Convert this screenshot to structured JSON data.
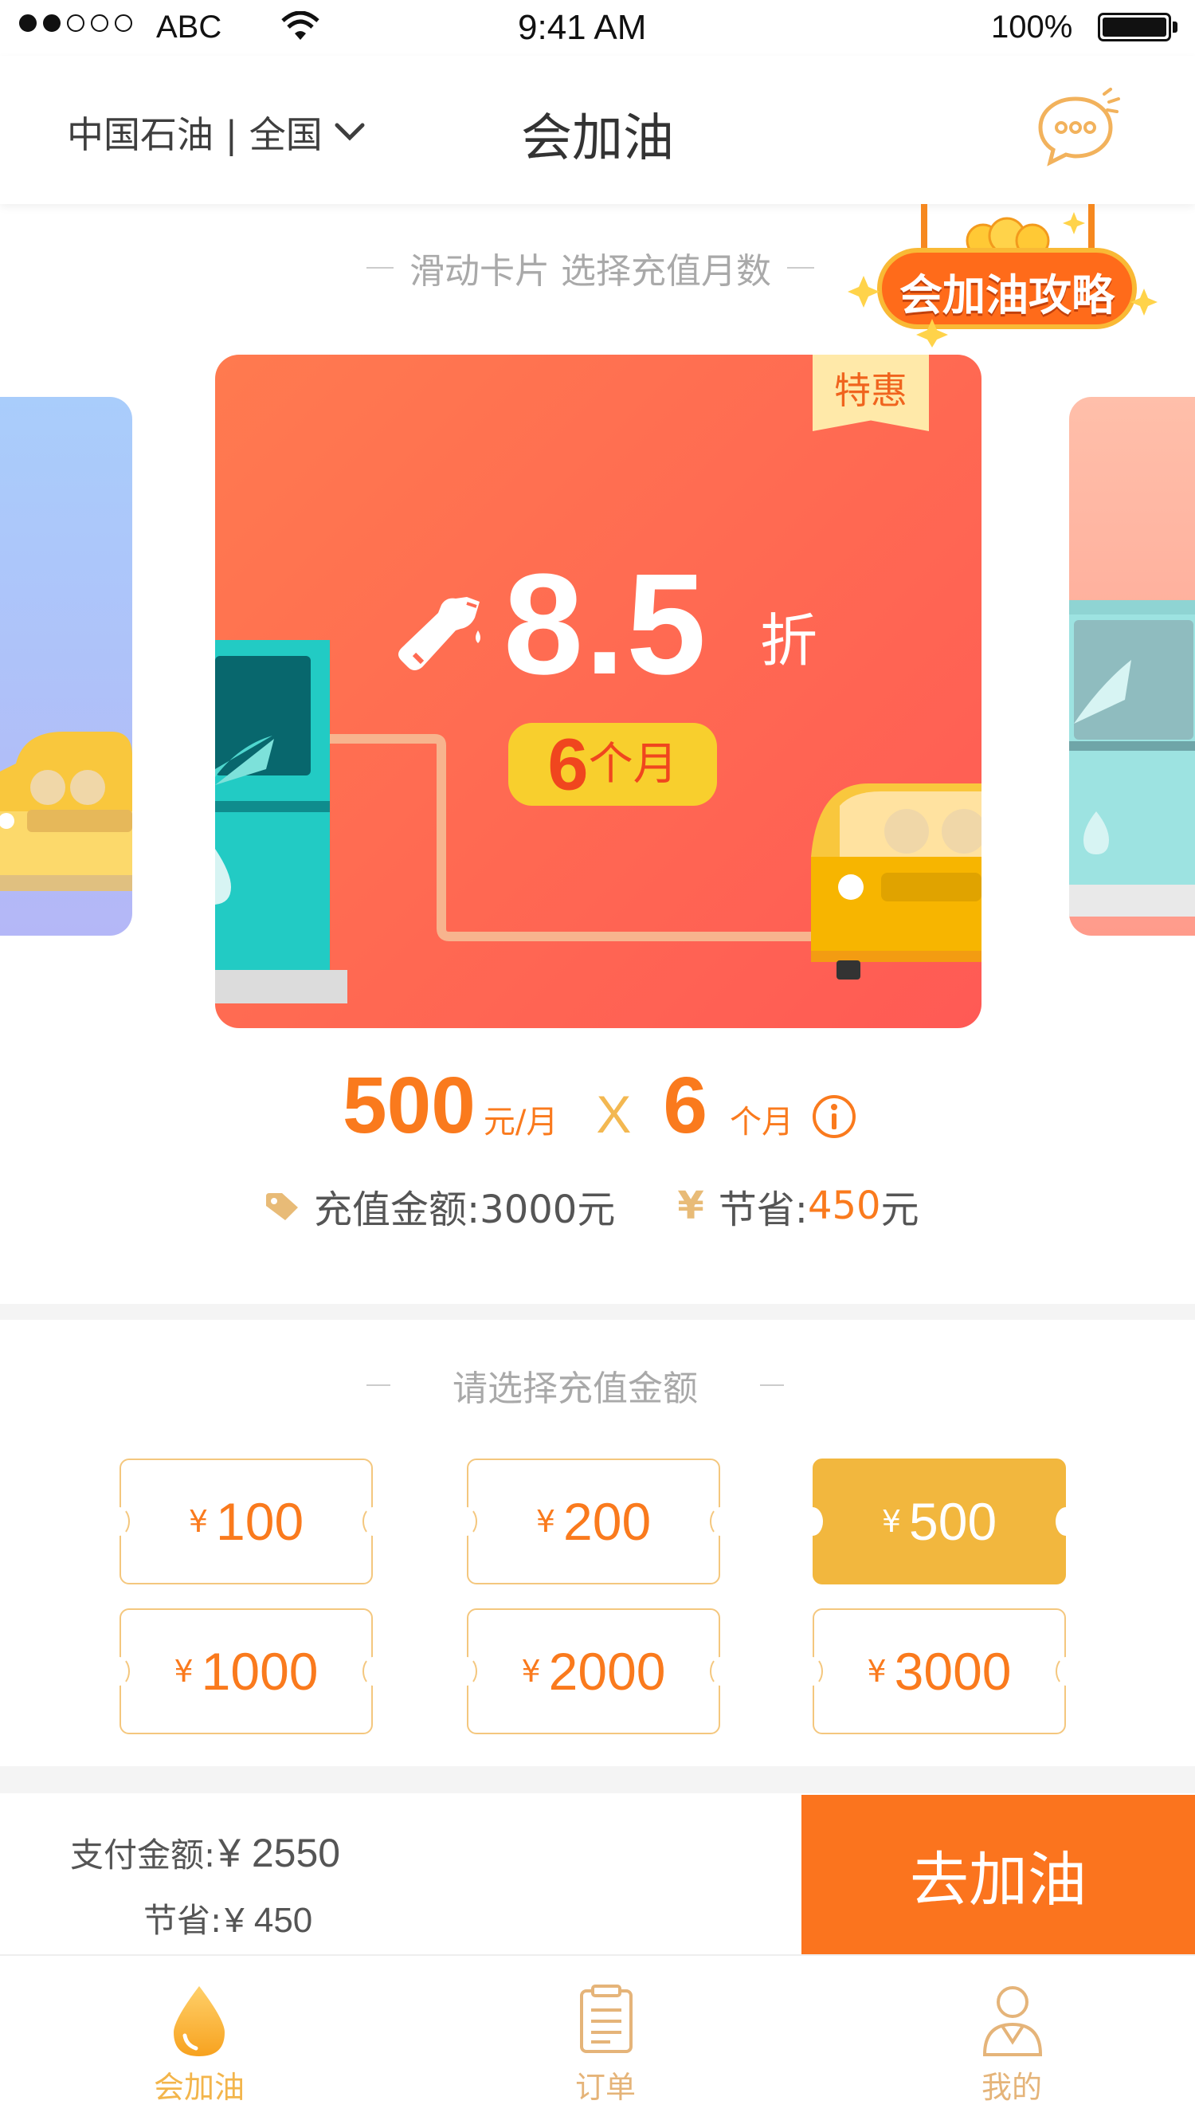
{
  "status_bar": {
    "carrier": "ABC",
    "time": "9:41 AM",
    "battery": "100%"
  },
  "nav": {
    "location": "中国石油 | 全国",
    "title": "会加油"
  },
  "banner": {
    "label": "会加油攻略"
  },
  "card_hint": "滑动卡片 选择充值月数",
  "card": {
    "badge": "特惠",
    "discount": "8.5",
    "discount_unit": "折",
    "months_num": "6",
    "months_unit": "个月"
  },
  "price": {
    "monthly": "500",
    "monthly_unit": "元/月",
    "times": "X",
    "months": "6",
    "months_unit": "个月"
  },
  "summary": {
    "recharge_label": "充值金额:3000元",
    "save_label": "节省:",
    "save_value": "450",
    "save_unit": "元"
  },
  "amount_hint": "请选择充值金额",
  "amounts": [
    {
      "yen": "¥",
      "value": "100",
      "selected": false
    },
    {
      "yen": "¥",
      "value": "200",
      "selected": false
    },
    {
      "yen": "¥",
      "value": "500",
      "selected": true
    },
    {
      "yen": "¥",
      "value": "1000",
      "selected": false
    },
    {
      "yen": "¥",
      "value": "2000",
      "selected": false
    },
    {
      "yen": "¥",
      "value": "3000",
      "selected": false
    }
  ],
  "footer": {
    "pay_label": "支付金额:",
    "pay_value": "¥ 2550",
    "save_label": "节省:",
    "save_value": "¥ 450",
    "go_button": "去加油"
  },
  "tabs": [
    {
      "label": "会加油",
      "active": true
    },
    {
      "label": "订单",
      "active": false
    },
    {
      "label": "我的",
      "active": false
    }
  ],
  "colors": {
    "accent": "#fb741e",
    "gold": "#f2b73e",
    "card_start": "#ff7a4f",
    "card_end": "#ff5a55"
  }
}
